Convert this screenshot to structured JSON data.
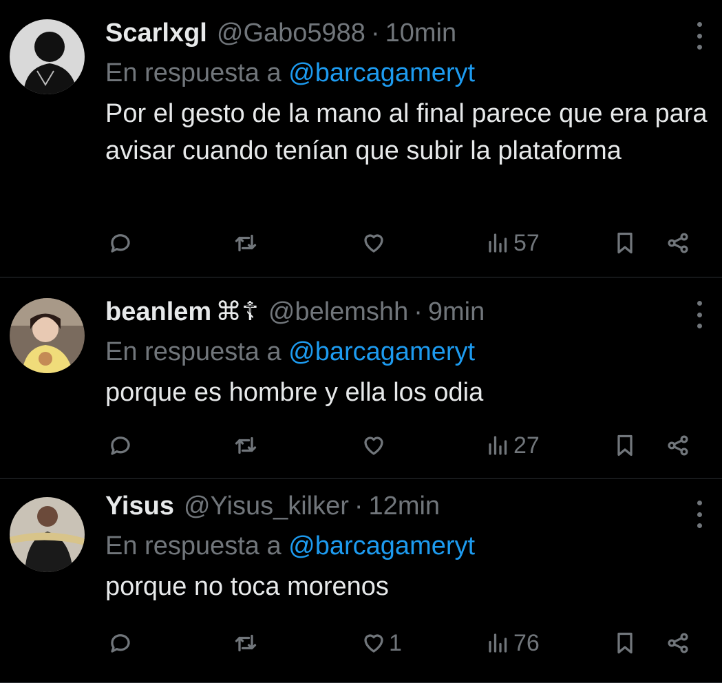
{
  "tweets": [
    {
      "name": "Scarlxgl",
      "emoji": "",
      "handle": "@Gabo5988",
      "separator": "·",
      "time": "10min",
      "reply_prefix": "En respuesta a",
      "reply_to": "@barcagameryt",
      "text": "Por el gesto de la mano al final parece que era para avisar cuando tenían que subir la plataforma",
      "likes": "",
      "views": "57"
    },
    {
      "name": "beanlem",
      "emoji": "⌘☦︎",
      "handle": "@belemshh",
      "separator": "·",
      "time": "9min",
      "reply_prefix": "En respuesta a",
      "reply_to": "@barcagameryt",
      "text": "porque es hombre y ella los odia",
      "likes": "",
      "views": "27"
    },
    {
      "name": "Yisus",
      "emoji": "",
      "handle": "@Yisus_kilker",
      "separator": "·",
      "time": "12min",
      "reply_prefix": "En respuesta a",
      "reply_to": "@barcagameryt",
      "text": "porque no toca morenos",
      "likes": "1",
      "views": "76"
    }
  ],
  "icons": {
    "reply": "reply-icon",
    "retweet": "retweet-icon",
    "like": "heart-icon",
    "views": "views-icon",
    "bookmark": "bookmark-icon",
    "share": "share-icon",
    "more": "more-icon"
  },
  "colors": {
    "background": "#000000",
    "text": "#e7e9ea",
    "muted": "#71767b",
    "accent": "#1d9bf0",
    "divider": "#2f3336"
  }
}
